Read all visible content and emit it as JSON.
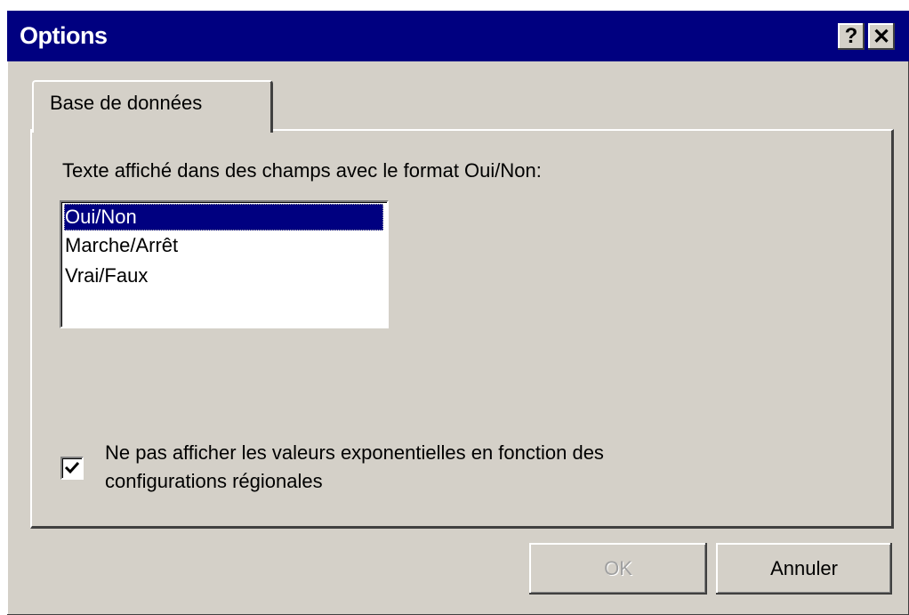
{
  "window": {
    "title": "Options",
    "help_label": "?",
    "close_label": "✕"
  },
  "tabs": [
    {
      "label": "Base de données",
      "active": true
    }
  ],
  "panel": {
    "prompt": "Texte affiché dans des champs avec le format Oui/Non:",
    "options": [
      {
        "label": "Oui/Non",
        "selected": true
      },
      {
        "label": "Marche/Arrêt",
        "selected": false
      },
      {
        "label": "Vrai/Faux",
        "selected": false
      }
    ],
    "checkbox": {
      "checked": true,
      "label_line1": "Ne pas afficher les valeurs exponentielles en fonction des",
      "label_line2": "configurations régionales"
    }
  },
  "buttons": {
    "ok_label": "OK",
    "ok_enabled": false,
    "cancel_label": "Annuler"
  },
  "colors": {
    "titlebar": "#000080",
    "face": "#d4d0c8",
    "selection": "#000080"
  }
}
